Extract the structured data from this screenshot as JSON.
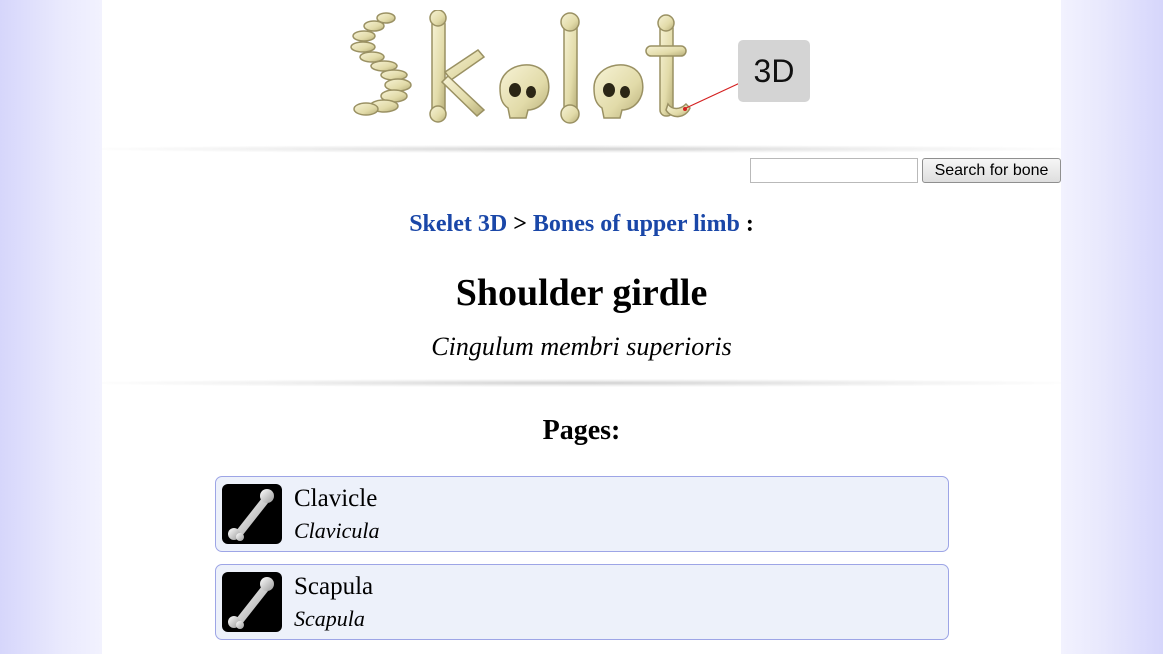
{
  "header": {
    "logo_text": "Skelet",
    "logo_badge": "3D"
  },
  "search": {
    "value": "",
    "button_label": "Search for bone"
  },
  "breadcrumb": {
    "items": [
      "Skelet 3D",
      "Bones of upper limb"
    ],
    "separator": ">",
    "trailing": ":"
  },
  "main": {
    "title": "Shoulder girdle",
    "latin_title": "Cingulum membri superioris",
    "pages_heading": "Pages:",
    "pages": [
      {
        "name": "Clavicle",
        "latin": "Clavicula",
        "icon": "bone-thumbnail-icon"
      },
      {
        "name": "Scapula",
        "latin": "Scapula",
        "icon": "bone-thumbnail-icon"
      }
    ]
  },
  "colors": {
    "link": "#1a47a8",
    "card_background": "#edf1fa",
    "card_border": "#9da5e6",
    "side_background": "#d6d6fb"
  }
}
